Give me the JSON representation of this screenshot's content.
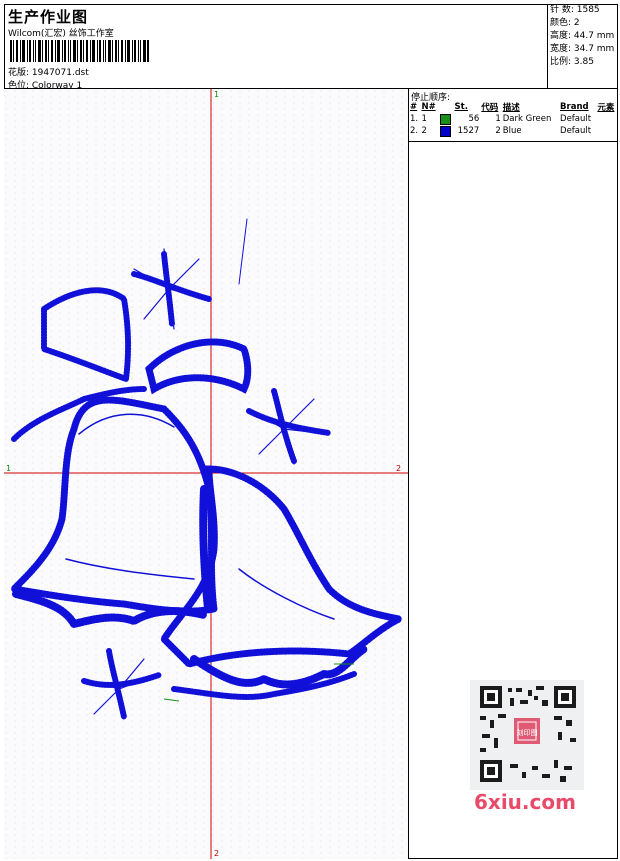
{
  "header": {
    "title": "生产作业图",
    "company": "Wilcom(汇宏) 丝饰工作室",
    "filename": "花版:  1947071.dst",
    "colorway": "色位:  Colorway 1"
  },
  "stats": {
    "stitches": "针 数:  1585",
    "colors": "颜色:  2",
    "height": "高度:  44.7 mm",
    "width": "宽度:  34.7 mm",
    "scale": "比例:  3.85"
  },
  "stop_sequence": {
    "title": "停止顺序:",
    "columns": [
      "#",
      "N#",
      "St.",
      "代码",
      "描述",
      "Brand",
      "元素"
    ],
    "rows": [
      {
        "idx": "1.",
        "n": "1",
        "color": "#1a8f1a",
        "st": "56",
        "code": "1",
        "desc": "Dark Green",
        "brand": "Default"
      },
      {
        "idx": "2.",
        "n": "2",
        "color": "#0000cc",
        "st": "1527",
        "code": "2",
        "desc": "Blue",
        "brand": "Default"
      }
    ]
  },
  "axes": {
    "top": "1",
    "bottom": "2",
    "left": "1",
    "right": "2"
  },
  "watermark": {
    "brand": "6xiu.com",
    "qr_stamp": "刻印图"
  },
  "colors": {
    "stitch_blue": "#1010d8",
    "axis_red": "#d00000",
    "brand_pink": "#e84a6a"
  }
}
